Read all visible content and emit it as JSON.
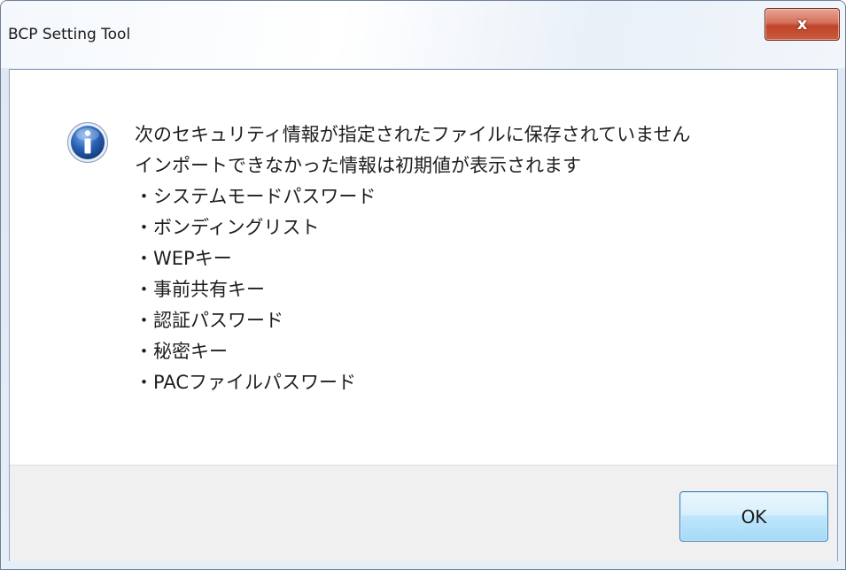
{
  "window": {
    "title": "BCP Setting Tool",
    "close_glyph": "x"
  },
  "dialog": {
    "icon": "info-icon",
    "message_lines": [
      "次のセキュリティ情報が指定されたファイルに保存されていません",
      "インポートできなかった情報は初期値が表示されます",
      "・システムモードパスワード",
      "・ボンディングリスト",
      "・WEPキー",
      "・事前共有キー",
      "・認証パスワード",
      "・秘密キー",
      "・PACファイルパスワード"
    ],
    "ok_label": "OK"
  },
  "colors": {
    "close_button": "#c9452c",
    "ok_button_border": "#3c7fb1",
    "info_icon": "#2a63b8",
    "footer_bg": "#f0f0f0"
  }
}
